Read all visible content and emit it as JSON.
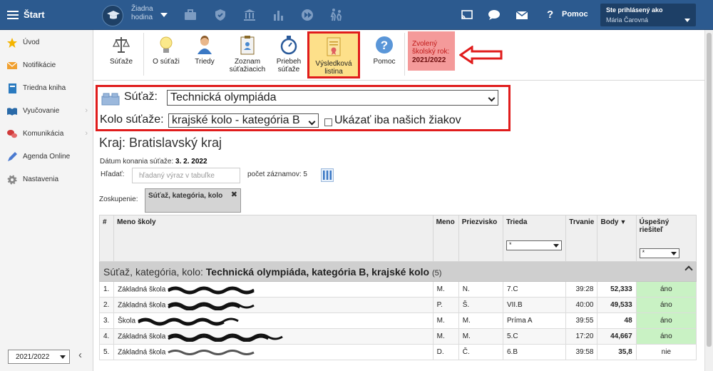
{
  "topbar": {
    "app_title": "Štart",
    "hour_label": "Žiadna hodina",
    "help_label": "Pomoc",
    "user_caption": "Ste prihlásený ako",
    "user_name": "Mária Čarovná",
    "icons": [
      "menu-icon",
      "graduation-cap-icon",
      "briefcase-icon",
      "shield-icon",
      "bank-icon",
      "bar-chart-icon",
      "chat-icon",
      "walking-kids-icon",
      "cast-icon",
      "messages-icon",
      "mail-icon",
      "help-icon"
    ]
  },
  "sidebar": {
    "items": [
      {
        "label": "Úvod",
        "icon": "star-icon",
        "color": "#f4b400"
      },
      {
        "label": "Notifikácie",
        "icon": "envelope-icon",
        "color": "#f0a030"
      },
      {
        "label": "Triedna kniha",
        "icon": "book-icon",
        "color": "#2a7abf"
      },
      {
        "label": "Vyučovanie",
        "icon": "open-book-icon",
        "color": "#2a6aa8",
        "chevron": "›"
      },
      {
        "label": "Komunikácia",
        "icon": "chat-bubbles-icon",
        "color": "#d03a3a",
        "chevron": "›"
      },
      {
        "label": "Agenda Online",
        "icon": "pen-icon",
        "color": "#4a7ad0"
      },
      {
        "label": "Nastavenia",
        "icon": "gear-icon",
        "color": "#888888"
      }
    ],
    "year_value": "2021/2022",
    "collapse_glyph": "‹"
  },
  "toolbar": {
    "buttons": [
      {
        "label": "Súťaže",
        "icon": "scales-icon"
      },
      {
        "label": "O súťaži",
        "icon": "lightbulb-icon"
      },
      {
        "label": "Triedy",
        "icon": "person-icon"
      },
      {
        "label": "Zoznam súťažiacich",
        "icon": "clipboard-list-icon"
      },
      {
        "label": "Priebeh súťaže",
        "icon": "stopwatch-icon"
      },
      {
        "label": "Výsledková listina",
        "icon": "certificate-icon",
        "selected": true
      },
      {
        "label": "Pomoc",
        "icon": "help-circle-icon"
      }
    ],
    "year_box_caption": "Zvolený školský rok:",
    "year_box_value": "2021/2022",
    "accent": "#e01c1c"
  },
  "filters": {
    "competition_label": "Súťaž:",
    "competition_value": "Technická olympiáda",
    "round_label": "Kolo súťaže:",
    "round_value": "krajské kolo - kategória B",
    "only_ours_label": "Ukázať iba našich žiakov",
    "only_ours_checked": false
  },
  "region_title": "Kraj: Bratislavský kraj",
  "date_label": "Dátum konania súťaže:",
  "date_value": "3. 2. 2022",
  "search_label": "Hľadať:",
  "search_placeholder": "hľadaný výraz v tabuľke",
  "record_count_label": "počet záznamov: 5",
  "grouping_label": "Zoskupenie:",
  "grouping_chip": "Súťaž, kategória, kolo",
  "grouping_remove": "✖",
  "table": {
    "headers": [
      "#",
      "Meno školy",
      "Meno",
      "Priezvisko",
      "Trieda",
      "Trvanie",
      "Body",
      "Úspešný riešiteľ"
    ],
    "trieda_filter": "*",
    "riesitel_filter": "*",
    "sort_glyph": "▼",
    "group_prefix": "Súťaž, kategória, kolo:",
    "group_value": "Technická olympiáda, kategória B, krajské kolo",
    "group_count": "(5)",
    "rows": [
      {
        "n": "1.",
        "school": "Základná škola",
        "meno": "M.",
        "priezvisko": "N.",
        "trieda": "7.C",
        "trvanie": "39:28",
        "body": "52,333",
        "uspesny": "áno"
      },
      {
        "n": "2.",
        "school": "Základná škola",
        "meno": "P.",
        "priezvisko": "Š.",
        "trieda": "VII.B",
        "trvanie": "40:00",
        "body": "49,533",
        "uspesny": "áno"
      },
      {
        "n": "3.",
        "school": "Škola",
        "meno": "M.",
        "priezvisko": "M.",
        "trieda": "Príma A",
        "trvanie": "39:55",
        "body": "48",
        "uspesny": "áno"
      },
      {
        "n": "4.",
        "school": "Základná škola",
        "meno": "M.",
        "priezvisko": "M.",
        "trieda": "5.C",
        "trvanie": "17:20",
        "body": "44,667",
        "uspesny": "áno"
      },
      {
        "n": "5.",
        "school": "Základná škola",
        "meno": "D.",
        "priezvisko": "Č.",
        "trieda": "6.B",
        "trvanie": "39:58",
        "body": "35,8",
        "uspesny": "nie"
      }
    ]
  }
}
